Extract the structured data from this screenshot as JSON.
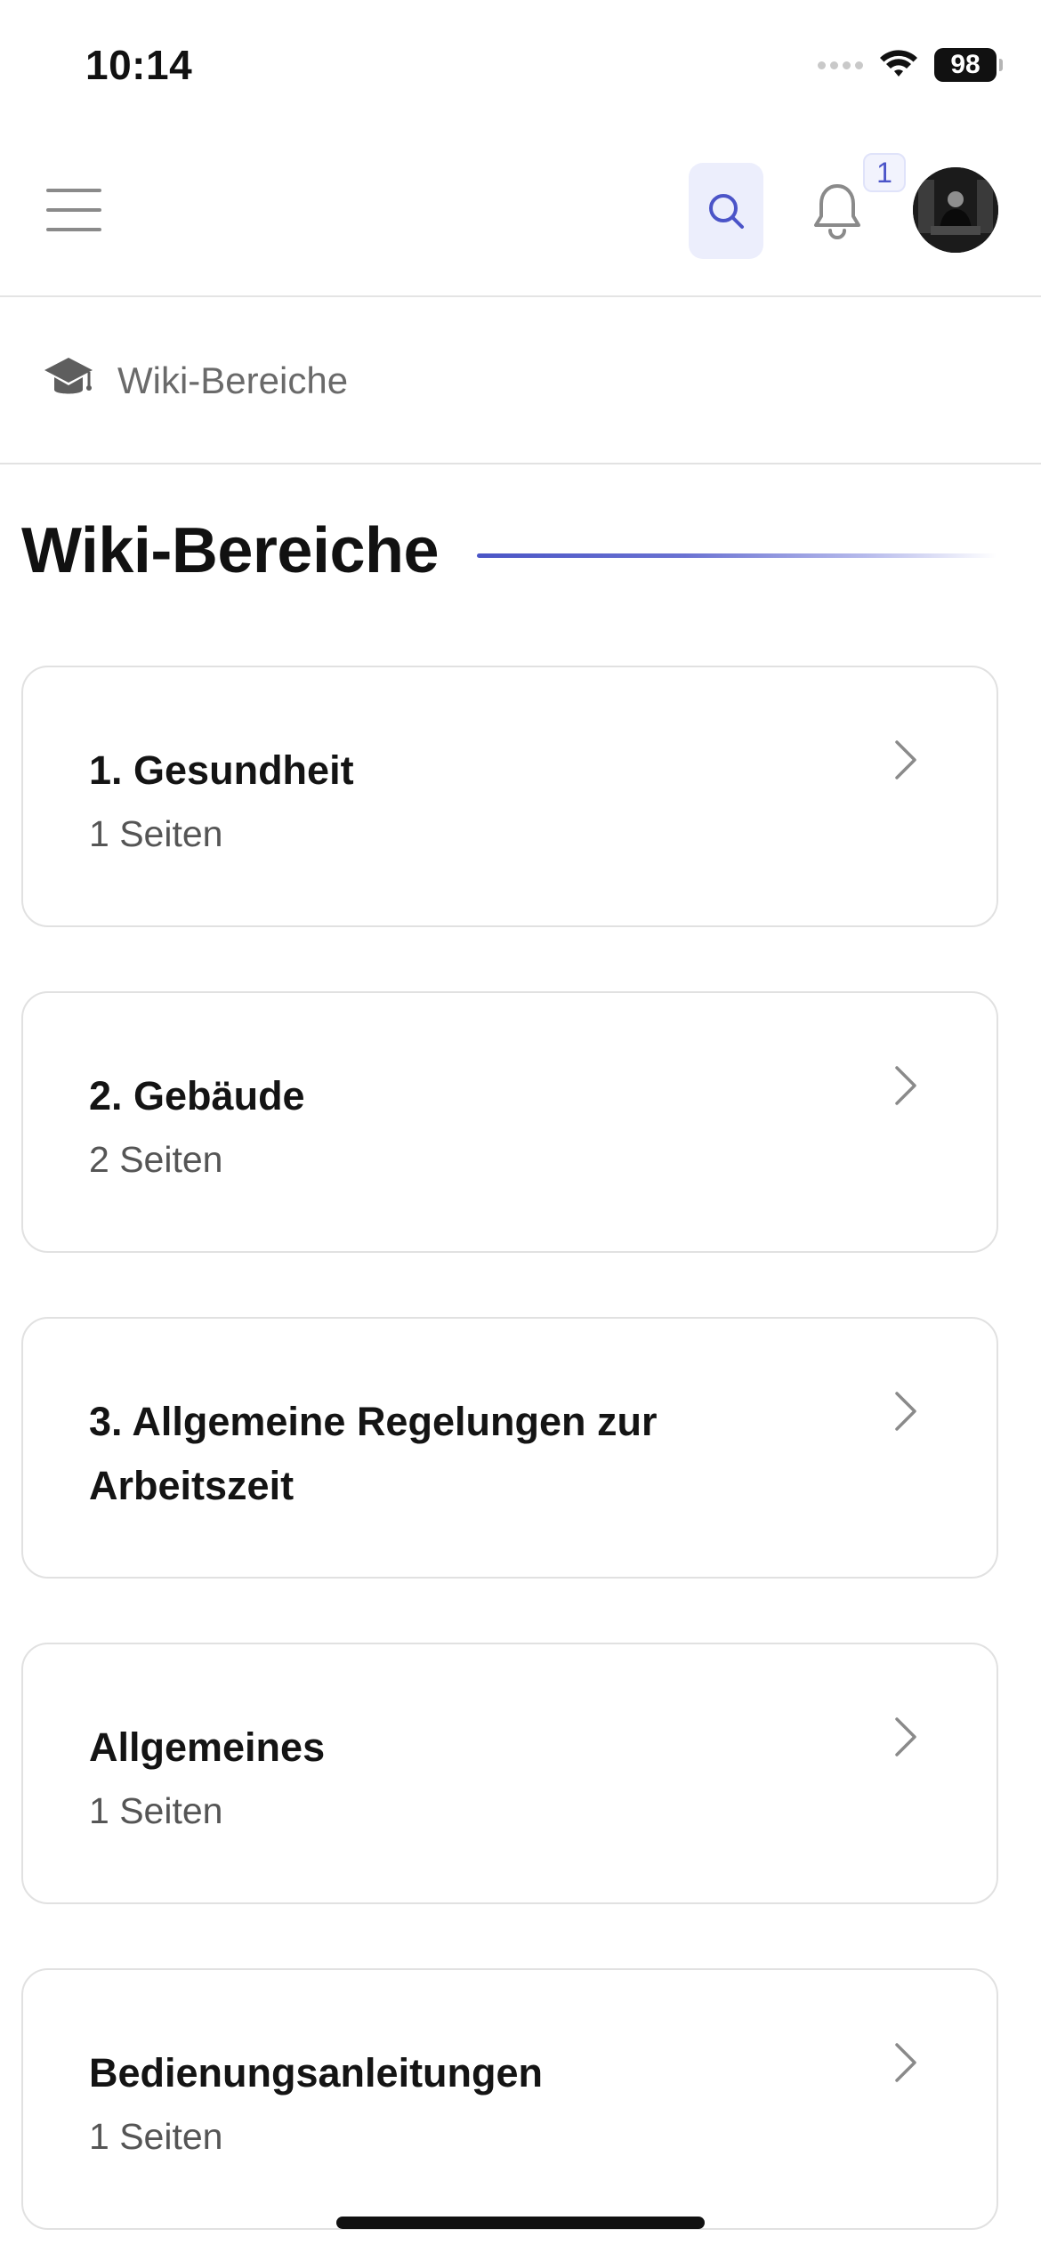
{
  "status_bar": {
    "time": "10:14",
    "battery": "98",
    "icons": [
      "cellular-signal-icon",
      "wifi-icon",
      "battery-icon"
    ]
  },
  "app_bar": {
    "icons": [
      "menu-icon",
      "search-icon",
      "bell-icon"
    ],
    "notification_count": "1",
    "accent_color": "#4B54C8",
    "search_bg_color": "#ECEEFC"
  },
  "breadcrumb": {
    "icon": "graduation-cap-icon",
    "label": "Wiki-Bereiche"
  },
  "page": {
    "title": "Wiki-Bereiche"
  },
  "wiki_areas": [
    {
      "title": "1. Gesundheit",
      "count": "1 Seiten"
    },
    {
      "title": "2. Gebäude",
      "count": "2 Seiten"
    },
    {
      "title": "3. Allgemeine Regelungen zur Arbeitszeit",
      "count": ""
    },
    {
      "title": "Allgemeines",
      "count": "1 Seiten"
    },
    {
      "title": "Bedienungsanleitungen",
      "count": "1 Seiten"
    }
  ]
}
